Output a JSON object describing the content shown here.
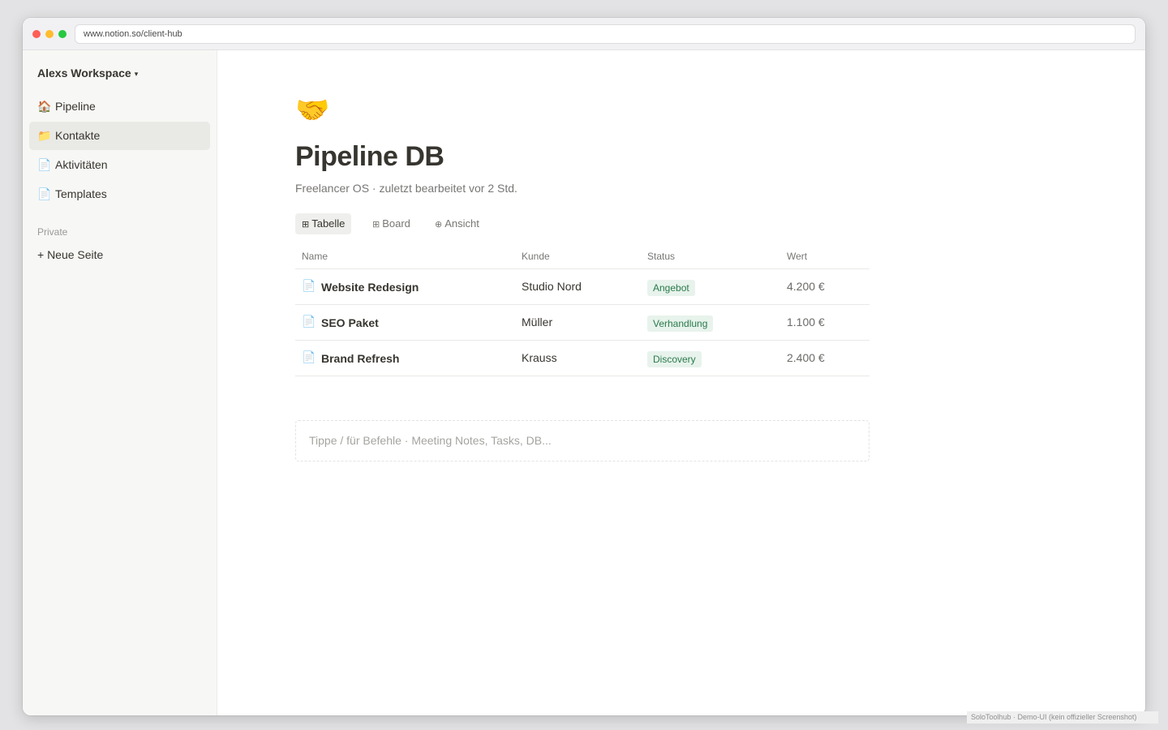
{
  "browser": {
    "url": "www.notion.so/client-hub"
  },
  "sidebar": {
    "workspace_name": "Alexs Workspace",
    "workspace_caret": "▾",
    "items": [
      {
        "icon": "🏠",
        "icon_name": "house-icon",
        "label": "Pipeline",
        "active": false
      },
      {
        "icon": "📁",
        "icon_name": "folder-icon",
        "label": "Kontakte",
        "active": true
      },
      {
        "icon": "📄",
        "icon_name": "page-icon",
        "label": "Aktivitäten",
        "active": false
      },
      {
        "icon": "📄",
        "icon_name": "page-icon",
        "label": "Templates",
        "active": false
      }
    ],
    "section_label": "Private",
    "new_page_label": "+ Neue Seite"
  },
  "page": {
    "emoji": "🤝",
    "title": "Pipeline DB",
    "subtitle": "Freelancer OS · zuletzt bearbeitet vor 2 Std."
  },
  "views": [
    {
      "icon": "⊞",
      "label": "Tabelle",
      "active": true
    },
    {
      "icon": "⊞",
      "label": "Board",
      "active": false
    },
    {
      "icon": "⊕",
      "label": "Ansicht",
      "active": false
    }
  ],
  "table": {
    "columns": [
      "Name",
      "Kunde",
      "Status",
      "Wert"
    ],
    "rows": [
      {
        "icon": "📄",
        "name": "Website Redesign",
        "kunde": "Studio Nord",
        "status": "Angebot",
        "wert": "4.200 €"
      },
      {
        "icon": "📄",
        "name": "SEO Paket",
        "kunde": "Müller",
        "status": "Verhandlung",
        "wert": "1.100 €"
      },
      {
        "icon": "📄",
        "name": "Brand Refresh",
        "kunde": "Krauss",
        "status": "Discovery",
        "wert": "2.400 €"
      }
    ]
  },
  "command_placeholder": "Tippe / für Befehle · Meeting Notes, Tasks, DB...",
  "watermark": "SoloToolhub · Demo-UI (kein offizieller Screenshot)",
  "colors": {
    "status_badge_bg": "#e7f3ec",
    "status_badge_text": "#2b7a4b",
    "sidebar_bg": "#f7f7f5",
    "active_item_bg": "#e9e9e6"
  }
}
